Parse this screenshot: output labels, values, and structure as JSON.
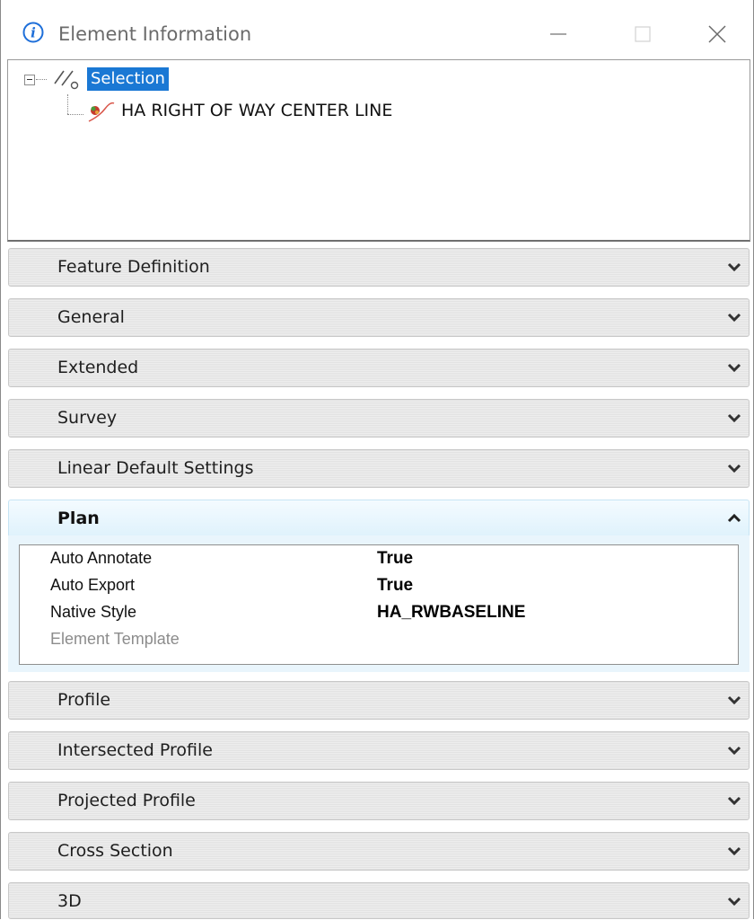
{
  "window": {
    "title": "Element Information"
  },
  "tree": {
    "root_label": "Selection",
    "child_label": "HA RIGHT OF WAY CENTER LINE"
  },
  "sections": {
    "feature_definition": "Feature Definition",
    "general": "General",
    "extended": "Extended",
    "survey": "Survey",
    "linear_default_settings": "Linear Default Settings",
    "plan": "Plan",
    "profile": "Profile",
    "intersected_profile": "Intersected Profile",
    "projected_profile": "Projected Profile",
    "cross_section": "Cross Section",
    "three_d": "3D"
  },
  "plan": {
    "properties": [
      {
        "name": "Auto Annotate",
        "value": "True"
      },
      {
        "name": "Auto Export",
        "value": "True"
      },
      {
        "name": "Native Style",
        "value": "HA_RWBASELINE"
      },
      {
        "name": "Element Template",
        "value": ""
      }
    ]
  },
  "colors": {
    "selection_highlight": "#1a78d4",
    "info_icon": "#1e6fd9",
    "expanded_section_bg": "#e4f4fd"
  },
  "icons": {
    "title": "info-icon",
    "minimize": "minimize-icon",
    "maximize": "maximize-icon",
    "close": "close-icon",
    "collapsed": "chevron-down-icon",
    "expanded": "chevron-up-icon"
  }
}
